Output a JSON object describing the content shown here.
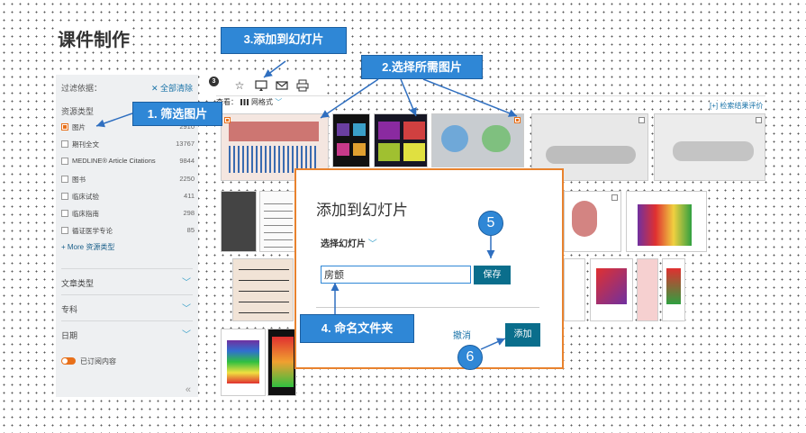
{
  "page": {
    "title": "课件制作"
  },
  "sidebar": {
    "filter_header": "过滤依据：",
    "clear_all": "✕ 全部清除",
    "resource_type_label": "资源类型",
    "resource_types": [
      {
        "label": "图片",
        "count": "2910",
        "checked": true
      },
      {
        "label": "期刊全文",
        "count": "13767",
        "checked": false
      },
      {
        "label": "MEDLINE® Article Citations",
        "count": "9844",
        "checked": false
      },
      {
        "label": "图书",
        "count": "2250",
        "checked": false
      },
      {
        "label": "临床试验",
        "count": "411",
        "checked": false
      },
      {
        "label": "临床指南",
        "count": "298",
        "checked": false
      },
      {
        "label": "循证医学专论",
        "count": "85",
        "checked": false
      }
    ],
    "more_types": "+ More 资源类型",
    "article_type": "文章类型",
    "specialty": "专科",
    "date": "日期",
    "subscribed_toggle": "已订阅内容",
    "collapse_icon": "«"
  },
  "toolbar": {
    "badge": "3",
    "view_label": "查看：",
    "view_mode": "网格式",
    "eval_link": "[+] 检索结果评价"
  },
  "callouts": {
    "step1": "1. 筛选图片",
    "step2": "2.选择所需图片",
    "step3": "3.添加到幻灯片",
    "step4": "4. 命名文件夹",
    "step5": "5",
    "step6": "6"
  },
  "dialog": {
    "title": "添加到幻灯片",
    "choose_slides": "选择幻灯片",
    "name_value": "房颤",
    "save_label": "保存",
    "cancel_label": "撤消",
    "add_label": "添加"
  },
  "colors": {
    "accent_blue": "#2f87d6",
    "teal_button": "#0a6e8c",
    "orange": "#e8701a"
  }
}
